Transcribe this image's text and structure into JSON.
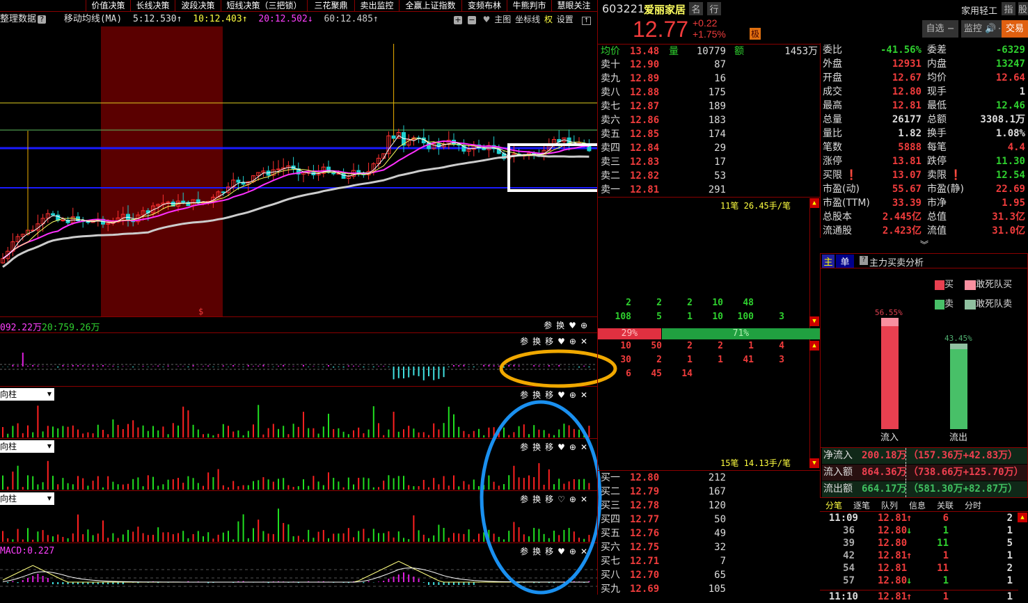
{
  "toolbar": {
    "buttons": [
      "价值决策",
      "长线决策",
      "波段决策",
      "短线决策（三把锁）",
      "三花聚鼎",
      "卖出监控",
      "全赢上证指数",
      "变频布林",
      "牛熊判市",
      "慧眼关注"
    ]
  },
  "ma_bar": {
    "title": "整理数据",
    "help": "?",
    "indicator": "移动均线(MA)",
    "ma5": "5:12.530↑",
    "ma10": "10:12.403↑",
    "ma20": "20:12.502↓",
    "ma60": "60:12.485↑",
    "tools": [
      "主图",
      "坐标线",
      "权",
      "设置"
    ]
  },
  "chart_marker": "$",
  "volume_bar": {
    "text1": "092.22万",
    "text2": "20:759.26万",
    "tools": "参换"
  },
  "panel_tools": "参换移",
  "panels": [
    {
      "dropdown": "向柱"
    },
    {
      "dropdown": "向柱"
    },
    {
      "dropdown": "向柱"
    }
  ],
  "macd": {
    "label": "MACD:0.227"
  },
  "stock": {
    "code": "603221",
    "name": "爱丽家居",
    "btn_name": "名",
    "btn_industry": "行",
    "price": "12.77",
    "change": "+0.22",
    "change_pct": "+1.75%",
    "badge": "极",
    "industry": "家用轻工",
    "btn_index": "指",
    "btn_stock": "股",
    "btn_watch": "自选 −",
    "btn_monitor": "监控 🔊",
    "btn_trade": "交易"
  },
  "book": {
    "header": {
      "avg_label": "均价",
      "avg": "13.48",
      "vol_label": "量",
      "vol": "10779",
      "amt_label": "额",
      "amt": "1453万"
    },
    "asks": [
      [
        "卖十",
        "12.90",
        "87"
      ],
      [
        "卖九",
        "12.89",
        "16"
      ],
      [
        "卖八",
        "12.88",
        "175"
      ],
      [
        "卖七",
        "12.87",
        "189"
      ],
      [
        "卖六",
        "12.86",
        "183"
      ],
      [
        "卖五",
        "12.85",
        "174"
      ],
      [
        "卖四",
        "12.84",
        "29"
      ],
      [
        "卖三",
        "12.83",
        "17"
      ],
      [
        "卖二",
        "12.82",
        "53"
      ],
      [
        "卖一",
        "12.81",
        "291"
      ]
    ],
    "ask_summary": "11笔 26.45手/笔",
    "ask_queue": [
      [
        "2",
        "2",
        "2",
        "10",
        "48",
        ""
      ],
      [
        "108",
        "5",
        "1",
        "10",
        "100",
        "3"
      ]
    ],
    "ratio_buy": "29%",
    "ratio_sell": "71%",
    "ratio_buy_value": 29,
    "bid_queue": [
      [
        "10",
        "50",
        "2",
        "2",
        "1",
        "4"
      ],
      [
        "30",
        "2",
        "1",
        "1",
        "41",
        "3"
      ],
      [
        "6",
        "45",
        "14",
        "",
        "",
        ""
      ]
    ],
    "bid_summary": "15笔 14.13手/笔",
    "bids": [
      [
        "买一",
        "12.80",
        "212"
      ],
      [
        "买二",
        "12.79",
        "167"
      ],
      [
        "买三",
        "12.78",
        "120"
      ],
      [
        "买四",
        "12.77",
        "50"
      ],
      [
        "买五",
        "12.76",
        "49"
      ],
      [
        "买六",
        "12.75",
        "32"
      ],
      [
        "买七",
        "12.71",
        "7"
      ],
      [
        "买八",
        "12.70",
        "65"
      ],
      [
        "买九",
        "12.69",
        "105"
      ]
    ]
  },
  "stats": [
    [
      "委比",
      "-41.56%",
      "grn",
      "委差",
      "-6329",
      "grn"
    ],
    [
      "外盘",
      "12931",
      "red",
      "内盘",
      "13247",
      "grn"
    ],
    [
      "开盘",
      "12.67",
      "red",
      "均价",
      "12.64",
      "red"
    ],
    [
      "成交",
      "12.80",
      "red",
      "现手",
      "1",
      "wht"
    ],
    [
      "最高",
      "12.81",
      "red",
      "最低",
      "12.46",
      "grn"
    ],
    [
      "总量",
      "26177",
      "wht",
      "总额",
      "3308.1万",
      "wht"
    ],
    [
      "量比",
      "1.82",
      "wht",
      "换手",
      "1.08%",
      "wht"
    ],
    [
      "笔数",
      "5888",
      "red",
      "每笔",
      "4.4",
      "red"
    ],
    [
      "涨停",
      "13.81",
      "red",
      "跌停",
      "11.30",
      "grn"
    ],
    [
      "买限 ❗",
      "13.07",
      "red",
      "卖限 ❗",
      "12.54",
      "grn"
    ],
    [
      "市盈(动)",
      "55.67",
      "red",
      "市盈(静)",
      "22.69",
      "red"
    ],
    [
      "市盈(TTM)",
      "33.39",
      "red",
      "市净",
      "1.95",
      "red"
    ],
    [
      "总股本",
      "2.445亿",
      "red",
      "总值",
      "31.3亿",
      "red"
    ],
    [
      "流通股",
      "2.423亿",
      "red",
      "流值",
      "31.0亿",
      "red"
    ]
  ],
  "analysis": {
    "tab_main": "主",
    "tab_order": "单",
    "title": "主力买卖分析",
    "legend": [
      "买",
      "敢死队买",
      "卖",
      "敢死队卖"
    ],
    "inflow_pct": "56.55%",
    "outflow_pct": "43.45%",
    "inflow_value": 56.55,
    "outflow_value": 43.45,
    "inflow_label": "流入",
    "outflow_label": "流出"
  },
  "flow": [
    [
      "净流入",
      "200.18万",
      "（157.36万+42.83万）"
    ],
    [
      "流入额",
      "864.36万",
      "（738.66万+125.70万）"
    ],
    [
      "流出额",
      "664.17万",
      "（581.30万+82.87万）"
    ]
  ],
  "tick_tabs": [
    "分笔",
    "逐笔",
    "队列",
    "信息",
    "关联",
    "分时"
  ],
  "ticks": [
    [
      "11:09",
      "12.81",
      "↑",
      "6",
      "2",
      "red"
    ],
    [
      "36",
      "12.80",
      "↓",
      "1",
      "1",
      "grn"
    ],
    [
      "39",
      "12.80",
      "",
      "11",
      "5",
      "grn"
    ],
    [
      "42",
      "12.81",
      "↑",
      "1",
      "1",
      "red"
    ],
    [
      "54",
      "12.81",
      "",
      "11",
      "2",
      "red"
    ],
    [
      "57",
      "12.80",
      "↓",
      "1",
      "1",
      "grn"
    ],
    [
      "11:10",
      "12.81",
      "↑",
      "1",
      "1",
      "red"
    ]
  ],
  "colors": {
    "up": "#f03c3c",
    "down": "#2fd02f",
    "border": "#8b0000",
    "accent": "#e86a10"
  }
}
